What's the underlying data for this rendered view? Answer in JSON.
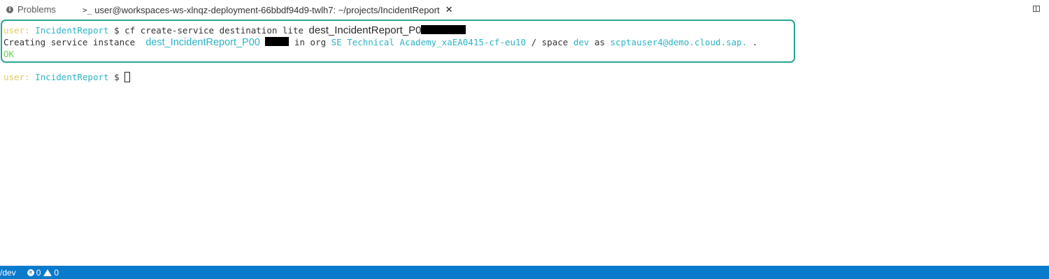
{
  "tabs": {
    "problems_label": "Problems",
    "terminal_prompt_icon": ">_",
    "terminal_title": "user@workspaces-ws-xlnqz-deployment-66bbdf94d9-twlh7: ~/projects/IncidentReport"
  },
  "terminal": {
    "prompt_user": "user:",
    "prompt_dir": "IncidentReport",
    "prompt_symbol": "$",
    "command": "cf create-service destination lite",
    "command_arg": "dest_IncidentReport_P0",
    "line2_prefix": "Creating service instance",
    "line2_instance": "dest_IncidentReport_P00",
    "line2_in_org": "in org",
    "org": "SE Technical Academy_xaEA0415-cf-eu10",
    "line2_space_sep": "/ space",
    "space": "dev",
    "line2_as": "as",
    "email": "scptauser4@demo.cloud.sap.",
    "line2_suffix": ".",
    "ok": "OK"
  },
  "statusbar": {
    "path": "/dev",
    "errors": "0",
    "warnings": "0"
  },
  "colors": {
    "prompt_user": "#e5c95b",
    "prompt_dir": "#2bb4c6",
    "ok": "#67d34c",
    "highlight_border": "#2aa592",
    "statusbar_bg": "#0a7acc"
  }
}
